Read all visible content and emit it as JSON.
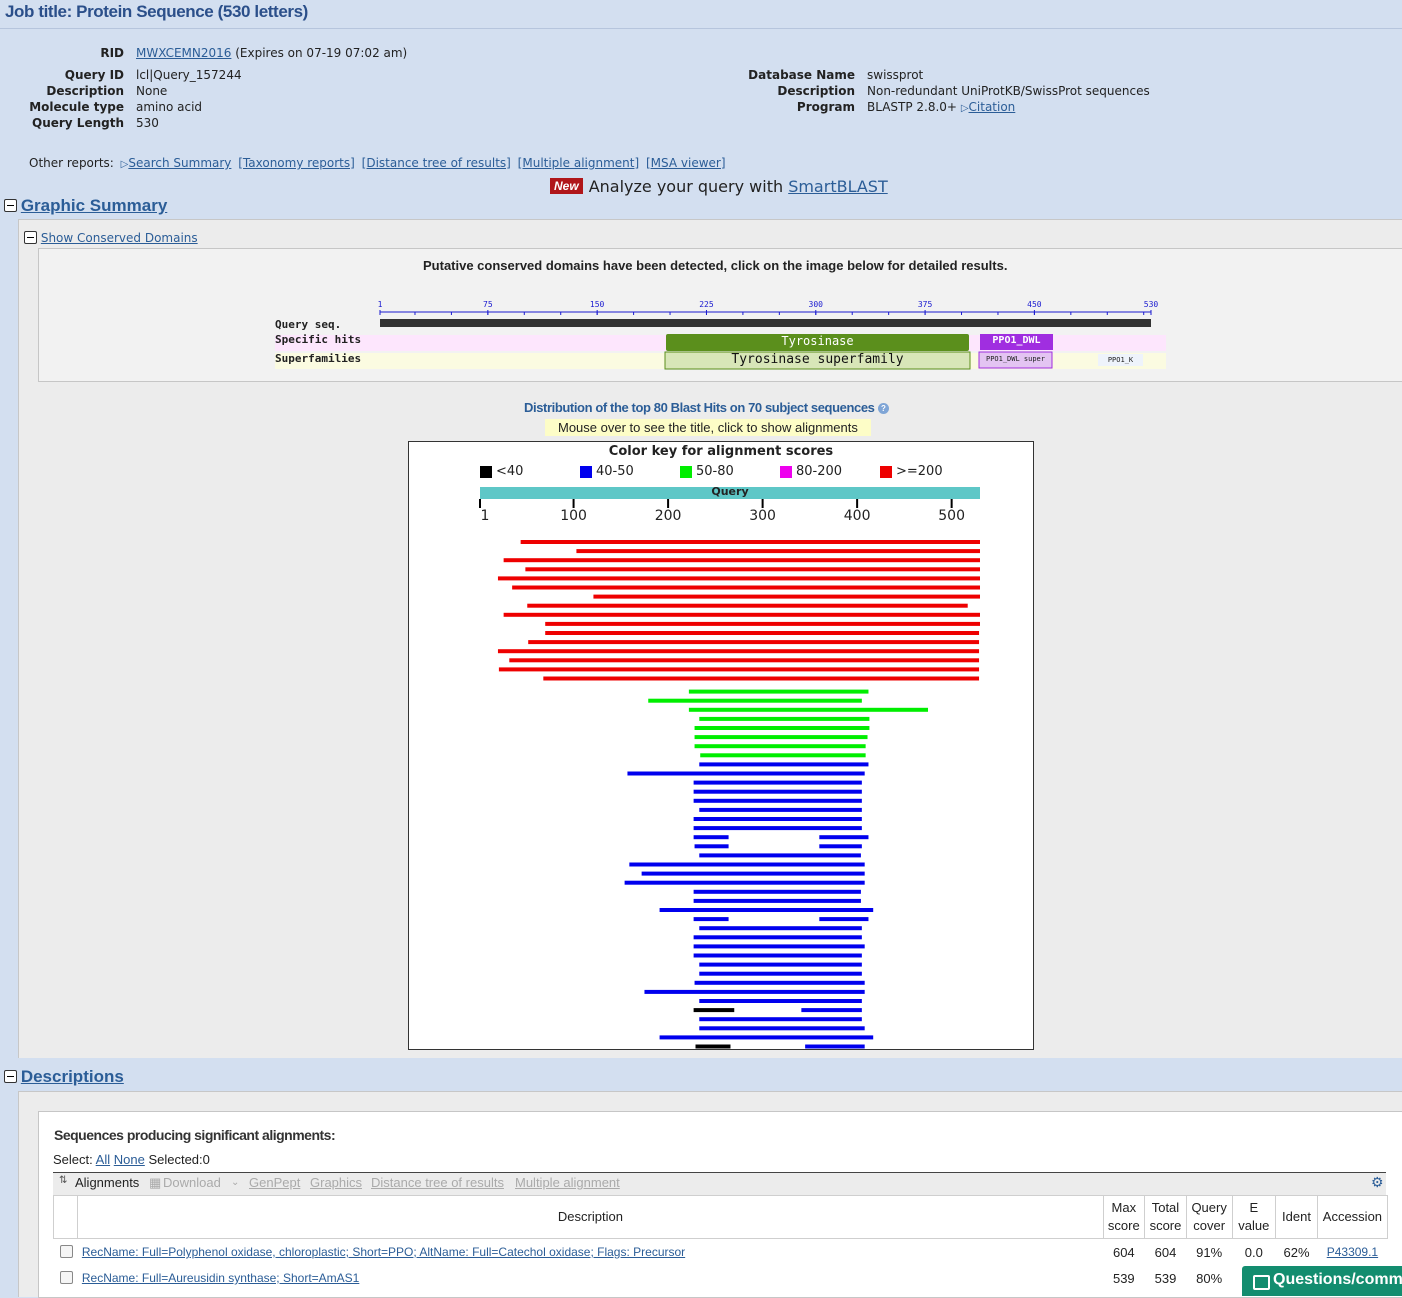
{
  "job_title": "Job title: Protein Sequence (530 letters)",
  "summary": {
    "rid_label": "RID",
    "rid_value": "MWXCEMN2016",
    "rid_expires": "(Expires on 07-19 07:02 am)",
    "left": [
      {
        "label": "Query ID",
        "value": "lcl|Query_157244"
      },
      {
        "label": "Description",
        "value": "None"
      },
      {
        "label": "Molecule type",
        "value": "amino acid"
      },
      {
        "label": "Query Length",
        "value": "530"
      }
    ],
    "right": [
      {
        "label": "Database Name",
        "value": "swissprot"
      },
      {
        "label": "Description",
        "value": "Non-redundant UniProtKB/SwissProt sequences"
      },
      {
        "label": "Program",
        "value": "BLASTP 2.8.0+"
      }
    ],
    "citation": "Citation"
  },
  "other_reports": {
    "label": "Other reports:",
    "links": [
      "Search Summary",
      "[Taxonomy reports]",
      "[Distance tree of results]",
      "[Multiple alignment]",
      "[MSA viewer]"
    ]
  },
  "smartblast": {
    "badge": "New",
    "text": "Analyze your query with ",
    "link": "SmartBLAST"
  },
  "graphic_summary": {
    "title": "Graphic Summary",
    "show_cd": "Show Conserved Domains",
    "cd_message": "Putative conserved domains have been detected, click on the image below for detailed results.",
    "cd_rows": [
      "Query seq.",
      "Specific hits",
      "Superfamilies"
    ],
    "cd_ticks": [
      "1",
      "75",
      "150",
      "225",
      "300",
      "375",
      "450",
      "530"
    ],
    "cd_domains": {
      "tyrosinase": "Tyrosinase",
      "tyr_super": "Tyrosinase superfamily",
      "ppo1": "PPO1_DWL",
      "ppo1_super": "PPO1_DWL super",
      "ppo1_k": "PPO1_K"
    },
    "dist_title": "Distribution of the top 80 Blast Hits on 70 subject sequences",
    "dist_note": "Mouse over to see the title, click to show alignments",
    "colorkey_title": "Color key for alignment scores",
    "colorkey": [
      {
        "label": "<40",
        "color": "#000000"
      },
      {
        "label": "40-50",
        "color": "#0000ee"
      },
      {
        "label": "50-80",
        "color": "#00ee00"
      },
      {
        "label": "80-200",
        "color": "#ee00ee"
      },
      {
        "label": ">=200",
        "color": "#ee0000"
      }
    ],
    "query_label": "Query",
    "axis_ticks": [
      "1",
      "100",
      "200",
      "300",
      "400",
      "500"
    ]
  },
  "descriptions": {
    "title": "Descriptions",
    "heading": "Sequences producing significant alignments:",
    "select_label": "Select:",
    "select_all": "All",
    "select_none": "None",
    "selected": "Selected:0",
    "toolbar": {
      "alignments": "Alignments",
      "download": "Download",
      "genpept": "GenPept",
      "graphics": "Graphics",
      "tree": "Distance tree of results",
      "msa": "Multiple alignment"
    },
    "columns": [
      "Description",
      "Max score",
      "Total score",
      "Query cover",
      "E value",
      "Ident",
      "Accession"
    ],
    "rows": [
      {
        "desc": "RecName: Full=Polyphenol oxidase, chloroplastic; Short=PPO; AltName: Full=Catechol oxidase; Flags: Precursor",
        "max": "604",
        "total": "604",
        "cover": "91%",
        "evalue": "0.0",
        "ident": "62%",
        "acc": "P43309.1"
      },
      {
        "desc": "RecName: Full=Aureusidin synthase; Short=AmAS1",
        "max": "539",
        "total": "539",
        "cover": "80%",
        "evalue": "",
        "ident": "",
        "acc": ""
      }
    ]
  },
  "feedback": "Questions/comm",
  "chart_data": {
    "type": "bar",
    "title": "Color key for alignment scores",
    "xlabel": "Query",
    "xlim": [
      1,
      530
    ],
    "ticks": [
      1,
      100,
      200,
      300,
      400,
      500
    ],
    "hits": [
      {
        "s": 44,
        "e": 530,
        "c": "red"
      },
      {
        "s": 103,
        "e": 530,
        "c": "red"
      },
      {
        "s": 26,
        "e": 530,
        "c": "red"
      },
      {
        "s": 49,
        "e": 530,
        "c": "red"
      },
      {
        "s": 20,
        "e": 530,
        "c": "red"
      },
      {
        "s": 35,
        "e": 530,
        "c": "red"
      },
      {
        "s": 121,
        "e": 530,
        "c": "red"
      },
      {
        "s": 51,
        "e": 517,
        "c": "red"
      },
      {
        "s": 26,
        "e": 530,
        "c": "red"
      },
      {
        "s": 70,
        "e": 530,
        "c": "red"
      },
      {
        "s": 70,
        "e": 529,
        "c": "red"
      },
      {
        "s": 52,
        "e": 529,
        "c": "red"
      },
      {
        "s": 20,
        "e": 529,
        "c": "red"
      },
      {
        "s": 32,
        "e": 529,
        "c": "red"
      },
      {
        "s": 21,
        "e": 529,
        "c": "red"
      },
      {
        "s": 68,
        "e": 529,
        "c": "red"
      },
      {
        "s": 222,
        "e": 412,
        "c": "green"
      },
      {
        "s": 179,
        "e": 405,
        "c": "green"
      },
      {
        "s": 222,
        "e": 475,
        "c": "green"
      },
      {
        "s": 233,
        "e": 413,
        "c": "green"
      },
      {
        "s": 228,
        "e": 413,
        "c": "green"
      },
      {
        "s": 228,
        "e": 411,
        "c": "green"
      },
      {
        "s": 228,
        "e": 409,
        "c": "green"
      },
      {
        "s": 234,
        "e": 409,
        "c": "green"
      },
      {
        "s": 233,
        "e": 412,
        "c": "blue"
      },
      {
        "s": 157,
        "e": 408,
        "c": "blue"
      },
      {
        "s": 227,
        "e": 405,
        "c": "blue"
      },
      {
        "s": 227,
        "e": 405,
        "c": "blue"
      },
      {
        "s": 227,
        "e": 405,
        "c": "blue"
      },
      {
        "s": 233,
        "e": 405,
        "c": "blue"
      },
      {
        "s": 227,
        "e": 405,
        "c": "blue"
      },
      {
        "s": 227,
        "e": 405,
        "c": "blue"
      },
      {
        "s": 227,
        "e": 264,
        "c": "blue",
        "s2": 360,
        "e2": 412
      },
      {
        "s": 228,
        "e": 264,
        "c": "blue",
        "s2": 360,
        "e2": 405
      },
      {
        "s": 233,
        "e": 404,
        "c": "blue"
      },
      {
        "s": 159,
        "e": 408,
        "c": "blue"
      },
      {
        "s": 172,
        "e": 408,
        "c": "blue"
      },
      {
        "s": 154,
        "e": 408,
        "c": "blue"
      },
      {
        "s": 227,
        "e": 404,
        "c": "blue"
      },
      {
        "s": 227,
        "e": 404,
        "c": "blue"
      },
      {
        "s": 191,
        "e": 417,
        "c": "blue"
      },
      {
        "s": 227,
        "e": 264,
        "c": "blue",
        "s2": 360,
        "e2": 412
      },
      {
        "s": 233,
        "e": 405,
        "c": "blue"
      },
      {
        "s": 227,
        "e": 405,
        "c": "blue"
      },
      {
        "s": 227,
        "e": 408,
        "c": "blue"
      },
      {
        "s": 227,
        "e": 405,
        "c": "blue"
      },
      {
        "s": 233,
        "e": 405,
        "c": "blue"
      },
      {
        "s": 233,
        "e": 405,
        "c": "blue"
      },
      {
        "s": 228,
        "e": 408,
        "c": "blue"
      },
      {
        "s": 175,
        "e": 408,
        "c": "blue"
      },
      {
        "s": 233,
        "e": 405,
        "c": "blue"
      },
      {
        "s": 227,
        "e": 270,
        "c": "black",
        "s2": 341,
        "e2": 405,
        "c2": "blue"
      },
      {
        "s": 233,
        "e": 405,
        "c": "blue"
      },
      {
        "s": 233,
        "e": 408,
        "c": "blue"
      },
      {
        "s": 191,
        "e": 417,
        "c": "blue"
      },
      {
        "s": 229,
        "e": 266,
        "c": "black",
        "s2": 345,
        "e2": 408,
        "c2": "blue"
      }
    ]
  }
}
